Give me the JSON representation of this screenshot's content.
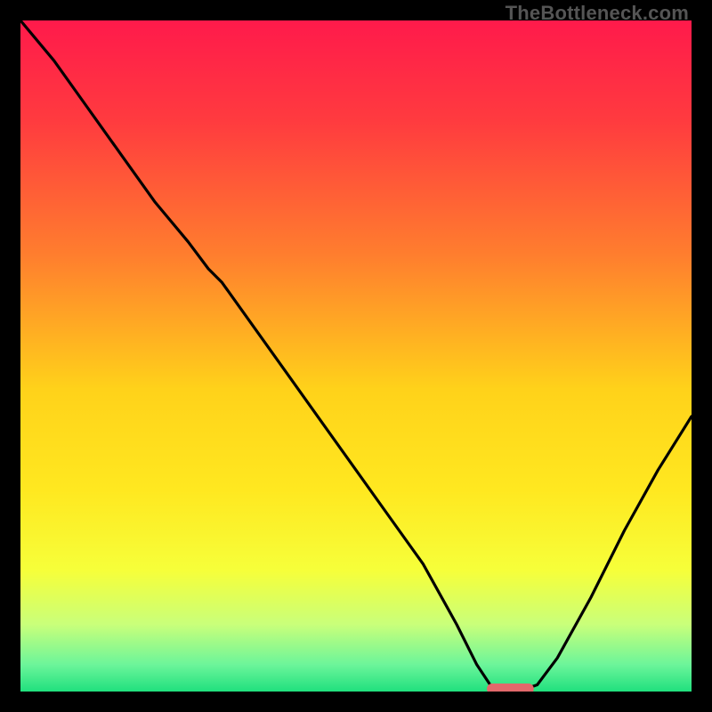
{
  "watermark": "TheBottleneck.com",
  "chart_data": {
    "type": "line",
    "title": "",
    "xlabel": "",
    "ylabel": "",
    "xlim": [
      0,
      100
    ],
    "ylim": [
      0,
      100
    ],
    "gradient_stops": [
      {
        "offset": 0.0,
        "color": "#ff1a4b"
      },
      {
        "offset": 0.15,
        "color": "#ff3b3f"
      },
      {
        "offset": 0.35,
        "color": "#ff7e2e"
      },
      {
        "offset": 0.55,
        "color": "#ffd21a"
      },
      {
        "offset": 0.7,
        "color": "#ffe820"
      },
      {
        "offset": 0.82,
        "color": "#f6ff3a"
      },
      {
        "offset": 0.9,
        "color": "#c9ff7a"
      },
      {
        "offset": 0.96,
        "color": "#6cf59a"
      },
      {
        "offset": 1.0,
        "color": "#20e07e"
      }
    ],
    "series": [
      {
        "name": "bottleneck-curve",
        "x": [
          0,
          5,
          10,
          15,
          20,
          25,
          28,
          30,
          35,
          40,
          45,
          50,
          55,
          60,
          65,
          68,
          70,
          72,
          73.5,
          75,
          77,
          80,
          85,
          90,
          95,
          100
        ],
        "y": [
          100,
          94,
          87,
          80,
          73,
          67,
          63,
          61,
          54,
          47,
          40,
          33,
          26,
          19,
          10,
          4,
          1,
          0.3,
          0.2,
          0.3,
          1,
          5,
          14,
          24,
          33,
          41
        ]
      }
    ],
    "marker": {
      "name": "optimal-zone",
      "x_center": 73,
      "x_halfwidth": 3.5,
      "y": 0.4,
      "color": "#e2686b"
    }
  }
}
